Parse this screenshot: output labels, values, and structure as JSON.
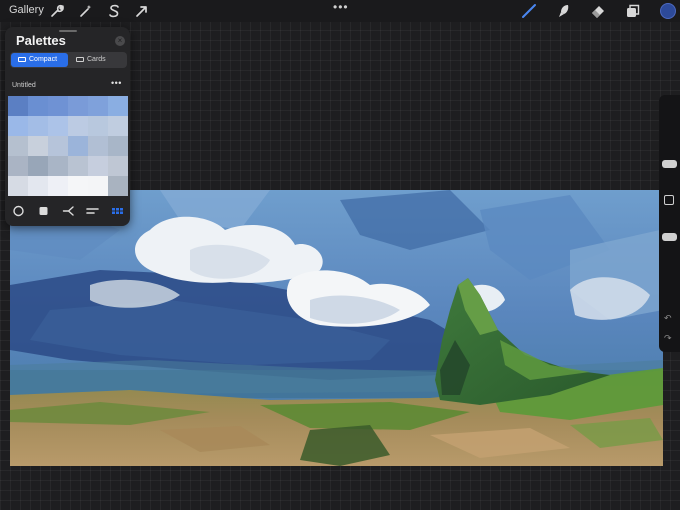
{
  "toolbar": {
    "gallery_label": "Gallery",
    "more_label": "•••",
    "left_icons": [
      "wrench-icon",
      "magic-wand-icon",
      "selection-s-icon",
      "transform-arrow-icon"
    ],
    "right_icons": [
      "brush-icon",
      "smudge-icon",
      "eraser-icon",
      "layers-icon"
    ],
    "active_color": "#2d4a9a"
  },
  "palettes": {
    "title": "Palettes",
    "close_label": "×",
    "tabs": [
      {
        "label": "Compact",
        "active": true
      },
      {
        "label": "Cards",
        "active": false
      }
    ],
    "palette_name": "Untitled",
    "palette_more": "•••",
    "swatches": [
      "#5b7fc3",
      "#6a8fd2",
      "#6f92d4",
      "#7a9bd8",
      "#7fa1db",
      "#8aaee2",
      "#9ab8e8",
      "#a3bde6",
      "#acc3e8",
      "#bccbe3",
      "#b8c8de",
      "#c0cde0",
      "#b5c0cf",
      "#c8d0dc",
      "#b6c4da",
      "#9bb4da",
      "#b1bfd4",
      "#a8b6c8",
      "#aab4c4",
      "#98a6b8",
      "#a9b5c6",
      "#b9c3d2",
      "#c6cede",
      "#bfc7d4",
      "#d6dbe4",
      "#e3e7ef",
      "#eef0f6",
      "#f5f6f8",
      "#f4f5f7",
      "#a9b3c0"
    ],
    "tools": [
      "disc-icon",
      "classic-icon",
      "harmony-icon",
      "value-icon",
      "palettes-grid-icon"
    ],
    "accent": "#2a6ee8"
  },
  "sidebar": {
    "undo_label": "↶",
    "redo_label": "↷"
  }
}
